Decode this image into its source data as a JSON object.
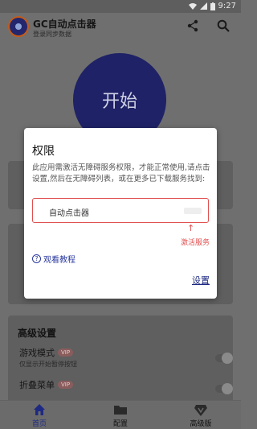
{
  "status_bar": {
    "time": "9:27"
  },
  "app": {
    "title": "GC自动点击器",
    "subtitle": "登录同步数据"
  },
  "main": {
    "start_label": "开始"
  },
  "advanced": {
    "title": "高级设置",
    "items": [
      {
        "label": "游戏模式",
        "badge": "VIP",
        "hint": "仅显示开始暂停按钮"
      },
      {
        "label": "折叠菜单",
        "badge": "VIP",
        "hint": ""
      }
    ]
  },
  "bottom_nav": [
    {
      "label": "首页",
      "icon": "home-icon",
      "active": true
    },
    {
      "label": "配置",
      "icon": "folder-icon",
      "active": false
    },
    {
      "label": "高级版",
      "icon": "vip-diamond-icon",
      "active": false
    }
  ],
  "dialog": {
    "title": "权限",
    "message": "此应用需激活无障碍服务权限，才能正常使用,请点击设置,然后在无障碍列表，或在更多已下载服务找到:",
    "service_label": "自动点击器",
    "activate_hint": "激活服务",
    "tutorial_label": "观看教程",
    "settings_label": "设置"
  },
  "colors": {
    "accent": "#1e2a82",
    "error": "#e05050",
    "overlay": "#6f6f6f"
  }
}
